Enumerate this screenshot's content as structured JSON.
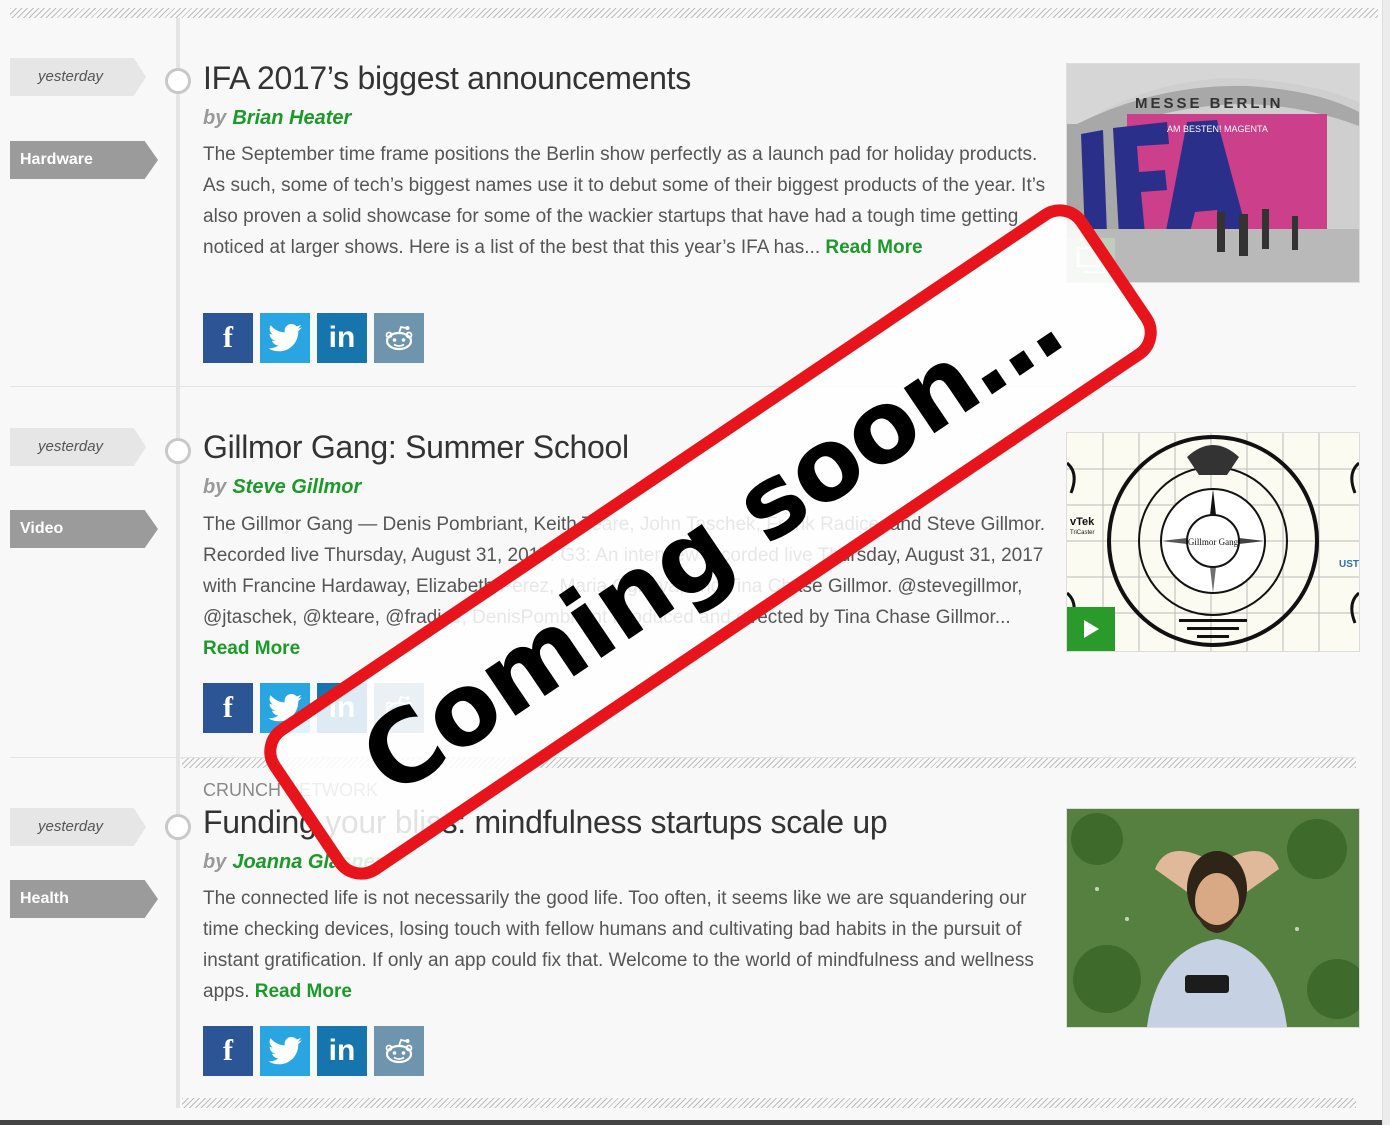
{
  "articles": [
    {
      "date": "yesterday",
      "category": "Hardware",
      "title": "IFA 2017’s biggest announcements",
      "by": "by",
      "author": "Brian Heater",
      "excerpt": "The September time frame positions the Berlin show perfectly as a launch pad for holiday products. As such, some of tech’s biggest names use it to debut some of their biggest products of the year. It’s also proven a solid showcase for some of the wackier startups that have had a tough time getting noticed at larger shows. Here is a list of the best that this year’s IFA has...",
      "read_more": "Read More",
      "image_text": {
        "sign": "MESSE BERLIN",
        "banner": "AM BESTEN! MAGENTA",
        "letters": "IFA"
      }
    },
    {
      "date": "yesterday",
      "category": "Video",
      "title": "Gillmor Gang: Summer School",
      "by": "by",
      "author": "Steve Gillmor",
      "excerpt": "The Gillmor Gang — Denis Pombriant, Keith Teare, John Taschek, Frank Radice, and Steve Gillmor. Recorded live Thursday, August 31, 2017. G3: An interview recorded live Thursday, August 31, 2017 with Francine Hardaway, Elizabeth Perez, Maria Ogneva, and Tina Chase Gillmor. @stevegillmor, @jtaschek, @kteare, @fradice, DenisPombriant Produced and directed by Tina Chase Gillmor...",
      "read_more": "Read More",
      "image_text": {
        "left": "vTek",
        "left_sub": "TriCaster",
        "right": "UST",
        "center": "Gillmor Gang"
      }
    },
    {
      "kicker": "CRUNCH NETWORK",
      "date": "yesterday",
      "category": "Health",
      "title": "Funding your bliss: mindfulness startups scale up",
      "by": "by",
      "author": "Joanna Glasner",
      "excerpt": "The connected life is not necessarily the good life. Too often, it seems like we are squandering our time checking devices, losing touch with fellow humans and cultivating bad habits in the pursuit of instant gratification. If only an app could fix that. Welcome to the world of mindfulness and wellness apps.",
      "read_more": "Read More"
    }
  ],
  "share": {
    "facebook": "f",
    "linkedin": "in"
  },
  "overlay": {
    "stamp_text": "Coming soon…",
    "stamp_color": "#e8141b"
  },
  "colors": {
    "accent_green": "#1b9a2a",
    "facebook": "#2b5595",
    "twitter": "#29a5e2",
    "linkedin": "#1775ae",
    "reddit": "#6f94ad"
  }
}
